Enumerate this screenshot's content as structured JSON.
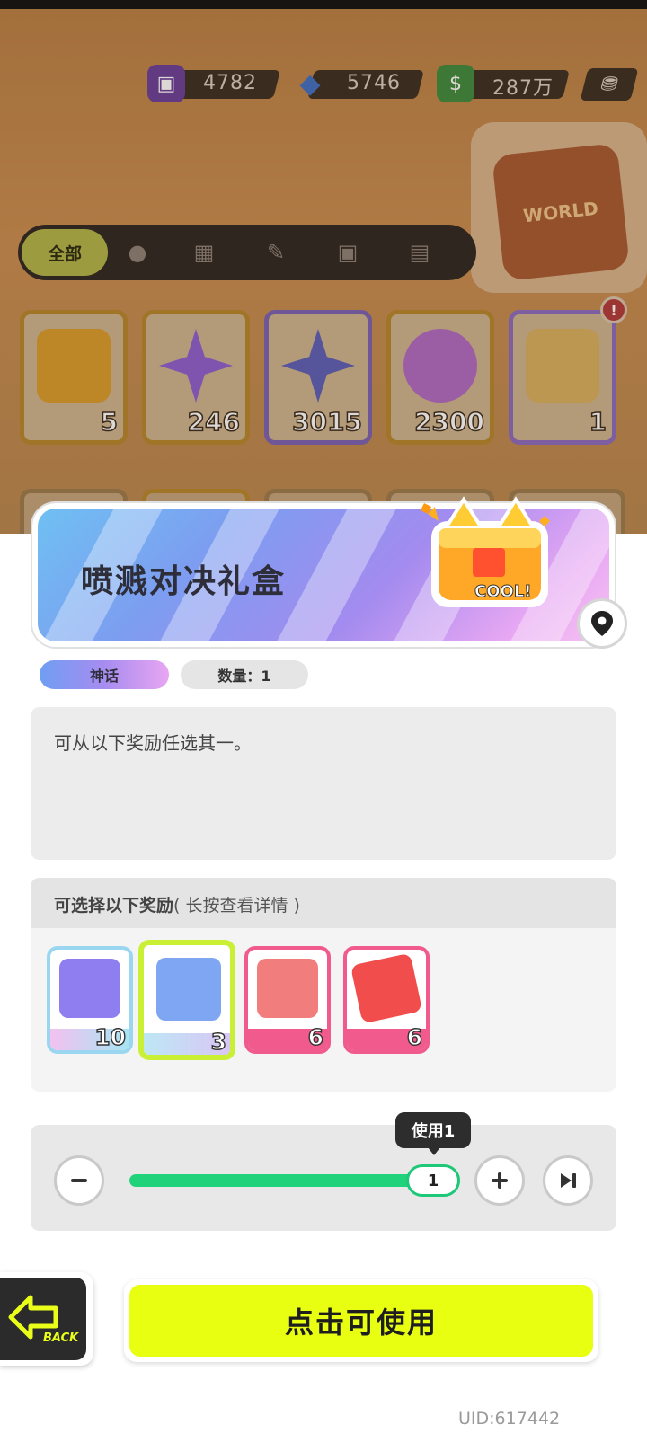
{
  "currencies": [
    {
      "icon": "paint-bucket-icon",
      "value": "4782"
    },
    {
      "icon": "diamond-icon",
      "value": "5746"
    },
    {
      "icon": "cash-icon",
      "value": "287万"
    }
  ],
  "world_badge": "WORLD",
  "filters": {
    "all_label": "全部",
    "icons": [
      "person-icon",
      "box-icon",
      "pen-icon",
      "card-icon",
      "book-icon"
    ]
  },
  "inventory": [
    {
      "count": "5",
      "color": "#d99b2a"
    },
    {
      "count": "246",
      "color": "#8e5fd0"
    },
    {
      "count": "3015",
      "color": "#5c5fb8"
    },
    {
      "count": "2300",
      "color": "#b06ac4"
    },
    {
      "count": "1",
      "color": "#d8b060"
    }
  ],
  "item": {
    "name": "喷溅对决礼盒",
    "gift_label": "COOL!",
    "rarity": "神话",
    "quantity_label": "数量：1",
    "description": "可从以下奖励任选其一。"
  },
  "rewards": {
    "title": "可选择以下奖励",
    "subtitle": "( 长按查看详情 )",
    "items": [
      {
        "count": "10",
        "border": "#9ad6f0",
        "art": "#8f7ef0",
        "selected": false
      },
      {
        "count": "3",
        "border": "#c9f035",
        "art": "#7fa6f3",
        "selected": true
      },
      {
        "count": "6",
        "border": "#f05a8d",
        "art": "#f27d7d",
        "selected": false
      },
      {
        "count": "6",
        "border": "#f05a8d",
        "art": "#f24d4d",
        "selected": false
      }
    ]
  },
  "slider": {
    "tooltip": "使用1",
    "value": "1",
    "fill_fraction": 1.0
  },
  "actions": {
    "back_label": "BACK",
    "use_label": "点击可使用"
  },
  "uid": "UID:617442",
  "colors": {
    "accent_yellow": "#e8ff12",
    "slider_green": "#20d27a",
    "mythic_gradient": [
      "#6f9ef3",
      "#a78cf0",
      "#e8a6f2"
    ]
  }
}
